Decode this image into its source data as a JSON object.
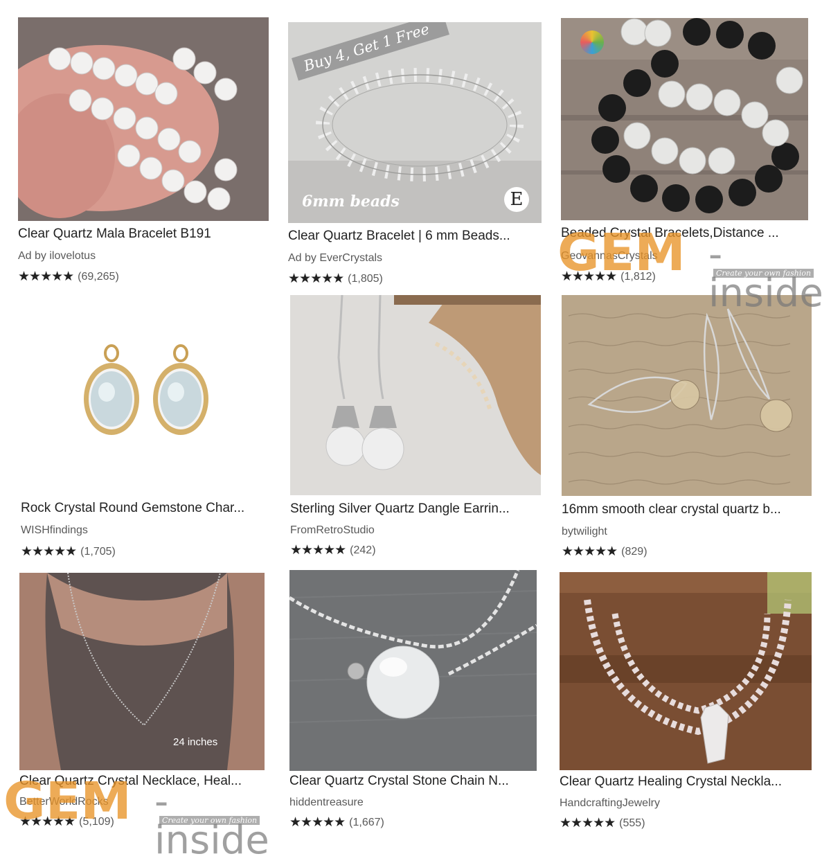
{
  "listings": [
    {
      "title": "Clear Quartz Mala Bracelet B191",
      "shop": "Ad by ilovelotus",
      "stars": "★★★★★",
      "review_count": "(69,265)"
    },
    {
      "title": "Clear Quartz Bracelet | 6 mm Beads...",
      "shop": "Ad by EverCrystals",
      "stars": "★★★★★",
      "review_count": "(1,805)",
      "promo": "Buy 4, Get 1 Free",
      "caption": "6mm beads",
      "badge": "E"
    },
    {
      "title": "Beaded Crystal Bracelets,Distance ...",
      "shop": "GeovannasCrystals",
      "stars": "★★★★★",
      "review_count": "(1,812)"
    },
    {
      "title": "Rock Crystal Round Gemstone Char...",
      "shop": "WISHfindings",
      "stars": "★★★★★",
      "review_count": "(1,705)"
    },
    {
      "title": "Sterling Silver Quartz Dangle Earrin...",
      "shop": "FromRetroStudio",
      "stars": "★★★★★",
      "review_count": "(242)"
    },
    {
      "title": "16mm smooth clear crystal quartz b...",
      "shop": "bytwilight",
      "stars": "★★★★★",
      "review_count": "(829)"
    },
    {
      "title": "Clear Quartz Crystal Necklace, Heal...",
      "shop": "BetterWorldRocks",
      "stars": "★★★★★",
      "review_count": "(5,109)",
      "caption": "24 inches"
    },
    {
      "title": "Clear Quartz Crystal Stone Chain N...",
      "shop": "hiddentreasure",
      "stars": "★★★★★",
      "review_count": "(1,667)"
    },
    {
      "title": "Clear Quartz Healing Crystal Neckla...",
      "shop": "HandcraftingJewelry",
      "stars": "★★★★★",
      "review_count": "(555)"
    }
  ],
  "watermark": {
    "mark": "GEM",
    "word": "-inside",
    "tagline": "Create your own fashion"
  },
  "colors": {
    "star": "#222222",
    "watermark_orange": "#e89428",
    "watermark_gray": "#787878"
  }
}
